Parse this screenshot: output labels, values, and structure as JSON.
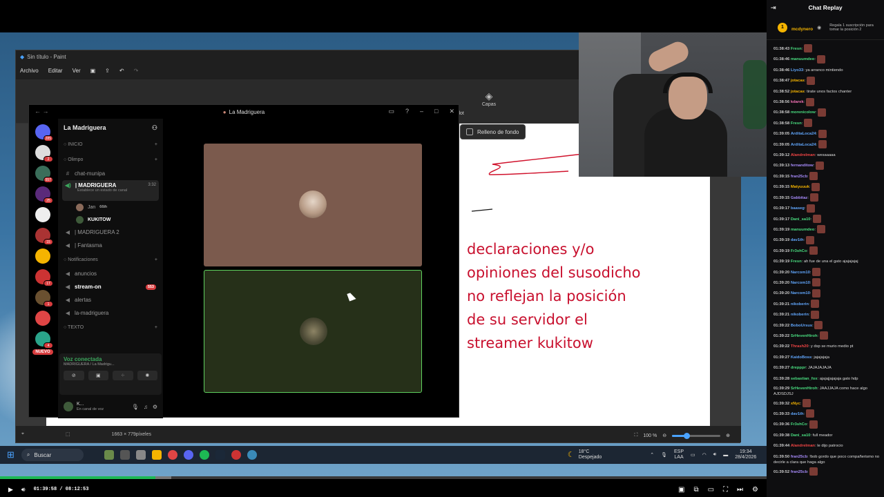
{
  "paint": {
    "title": "Sin título - Paint",
    "menu": [
      "Archivo",
      "Editar",
      "Ver"
    ],
    "copilot": "pilot",
    "capas": "Capas",
    "relleno": "Relleno de fondo",
    "status_size": "1663 × 779píxeles",
    "zoom": "100 %",
    "zoom_fill": 0.3
  },
  "canvas_text": [
    "declaraciones y/o",
    "opiniones del susodicho",
    "no reflejan la posición",
    "de su servidor el",
    "streamer kukitow"
  ],
  "discord": {
    "window_title": "La Madriguera",
    "guild": "La Madriguera",
    "server_badges": [
      "285",
      "2",
      "557",
      "25",
      "",
      "15",
      "",
      "17",
      "1",
      "4"
    ],
    "nuevo": "NUEVO",
    "cat_inicio": "INICIO",
    "cat_olimpo": "Olimpo",
    "chan_chatmunipa": "chat-munipa",
    "active_channel": "| MADRIGUERA",
    "active_sub": "Establece un estado de canal",
    "active_time": "3:32",
    "voice_users": [
      {
        "name": "Jan",
        "extra": "66th"
      },
      {
        "name": "KUKITOW",
        "extra": ""
      }
    ],
    "chan_madriguera2": "| MADRIGUERA 2",
    "chan_fantasma": "| Fantasma",
    "cat_notif": "Notificaciones",
    "chan_anuncios": "anuncios",
    "chan_streamon": "stream-on",
    "streamon_count": "553",
    "chan_alertas": "alertas",
    "chan_lamadriguera": "la-madriguera",
    "cat_texto": "TEXTO",
    "voice_connected": "Voz conectada",
    "voice_sub": "MADRIGUERA / La Madrigu...",
    "user_name": "K...",
    "user_status": "En canal de voz"
  },
  "taskbar": {
    "search": "Buscar",
    "temp": "18°C",
    "weather": "Despejado",
    "lang1": "ESP",
    "lang2": "LAA",
    "time": "19:34",
    "date": "28/4/2026"
  },
  "player": {
    "time": "01:39:58 / 08:12:53",
    "progress": 0.203
  },
  "chat": {
    "title": "Chat Replay",
    "top_user": "mcdynero",
    "top_rank": "1",
    "gift_text": "Regala 1 suscripción para tomar la posición 2",
    "messages": [
      {
        "ts": "01:38:43",
        "user": "Fresn",
        "color": "#4ade80",
        "text": "",
        "emote": true
      },
      {
        "ts": "01:38:46",
        "user": "manuumdeo",
        "color": "#4ade80",
        "text": "",
        "emote": true
      },
      {
        "ts": "01:38:46",
        "user": "Liyo33",
        "color": "#60a5fa",
        "text": "ya arranco mintiendo",
        "emote": false
      },
      {
        "ts": "01:38:47",
        "user": "jotacas",
        "color": "#f5b400",
        "text": "",
        "emote": true
      },
      {
        "ts": "01:38:52",
        "user": "jotacas",
        "color": "#f5b400",
        "text": "tirate unos factos chanter",
        "emote": false
      },
      {
        "ts": "01:38:56",
        "user": "kdarek",
        "color": "#f472b6",
        "text": "",
        "emote": true
      },
      {
        "ts": "01:38:58",
        "user": "morenicolow",
        "color": "#4ade80",
        "text": "",
        "emote": true
      },
      {
        "ts": "01:38:58",
        "user": "Fresn",
        "color": "#4ade80",
        "text": "",
        "emote": true
      },
      {
        "ts": "01:39:05",
        "user": "ArditaLoca24",
        "color": "#60a5fa",
        "text": "",
        "emote": true
      },
      {
        "ts": "01:39:05",
        "user": "ArditaLoca24",
        "color": "#60a5fa",
        "text": "",
        "emote": true
      },
      {
        "ts": "01:39:12",
        "user": "Alandrelman",
        "color": "#ef4444",
        "text": "wesaaaaa",
        "emote": false
      },
      {
        "ts": "01:39:13",
        "user": "fernanditow",
        "color": "#a78bfa",
        "text": "",
        "emote": true
      },
      {
        "ts": "01:39:15",
        "user": "fran25cb",
        "color": "#a78bfa",
        "text": "",
        "emote": true
      },
      {
        "ts": "01:39:15",
        "user": "Matyuuuk",
        "color": "#f5b400",
        "text": "",
        "emote": true
      },
      {
        "ts": "01:39:15",
        "user": "Gabbitaz",
        "color": "#a78bfa",
        "text": "",
        "emote": true
      },
      {
        "ts": "01:39:17",
        "user": "baaseg",
        "color": "#60a5fa",
        "text": "",
        "emote": true
      },
      {
        "ts": "01:39:17",
        "user": "Dani_sa10",
        "color": "#4ade80",
        "text": "",
        "emote": true
      },
      {
        "ts": "01:39:19",
        "user": "manuumdeo",
        "color": "#4ade80",
        "text": "",
        "emote": true
      },
      {
        "ts": "01:39:19",
        "user": "dav1th",
        "color": "#60a5fa",
        "text": "",
        "emote": true
      },
      {
        "ts": "01:39:19",
        "user": "Fr3shCo",
        "color": "#4ade80",
        "text": "",
        "emote": true
      },
      {
        "ts": "01:39:19",
        "user": "Fresn",
        "color": "#4ade80",
        "text": "ah fue de una el gato ajajajajaj",
        "emote": false
      },
      {
        "ts": "01:39:20",
        "user": "Narcom10",
        "color": "#60a5fa",
        "text": "",
        "emote": true
      },
      {
        "ts": "01:39:20",
        "user": "Narcom10",
        "color": "#60a5fa",
        "text": "",
        "emote": true
      },
      {
        "ts": "01:39:20",
        "user": "Narcom10",
        "color": "#60a5fa",
        "text": "",
        "emote": true
      },
      {
        "ts": "01:39:21",
        "user": "nikoberin",
        "color": "#60a5fa",
        "text": "",
        "emote": true
      },
      {
        "ts": "01:39:21",
        "user": "nikoberin",
        "color": "#60a5fa",
        "text": "",
        "emote": true
      },
      {
        "ts": "01:39:22",
        "user": "BoboUrsus",
        "color": "#60a5fa",
        "text": "",
        "emote": true
      },
      {
        "ts": "01:39:22",
        "user": "SrHevenHiroh",
        "color": "#4ade80",
        "text": "",
        "emote": true
      },
      {
        "ts": "01:39:22",
        "user": "Thrash20",
        "color": "#ef4444",
        "text": "y dsp se murio medio pt",
        "emote": false
      },
      {
        "ts": "01:39:27",
        "user": "KaidoBoss",
        "color": "#60a5fa",
        "text": "jajajajaja",
        "emote": false
      },
      {
        "ts": "01:39:27",
        "user": "drepppr",
        "color": "#4ade80",
        "text": "JAJAJAJAJA",
        "emote": false
      }
    ],
    "wrapped1": {
      "ts": "01:39:28",
      "user": "sebastian_fox",
      "color": "#4ade80",
      "text": "ajajajjajajaja gato hdp"
    },
    "wrapped2": {
      "ts": "01:39:29",
      "user": "SrHevenHiroh",
      "color": "#4ade80",
      "text": "JAAJJAJA como hace algo AJDSDJSJ"
    },
    "messages2": [
      {
        "ts": "01:39:32",
        "user": "xNyc",
        "color": "#f5b400",
        "text": "",
        "emote": true
      },
      {
        "ts": "01:39:33",
        "user": "dav1th",
        "color": "#60a5fa",
        "text": "",
        "emote": true
      },
      {
        "ts": "01:39:36",
        "user": "Fr3shCo",
        "color": "#4ade80",
        "text": "",
        "emote": true
      },
      {
        "ts": "01:39:38",
        "user": "Dani_sa10",
        "color": "#4ade80",
        "text": "full meador",
        "emote": false
      },
      {
        "ts": "01:39:44",
        "user": "Alandrelman",
        "color": "#ef4444",
        "text": "le dijo patrocio",
        "emote": false
      }
    ],
    "wrapped3": {
      "ts": "01:39:50",
      "user": "fran25cb",
      "color": "#a78bfa",
      "text": "!bob gordo que poco compañerismo no decirle a clara que haga algo"
    },
    "last": {
      "ts": "01:39:52",
      "user": "fran25cb",
      "color": "#a78bfa",
      "text": "",
      "emote": true
    }
  }
}
